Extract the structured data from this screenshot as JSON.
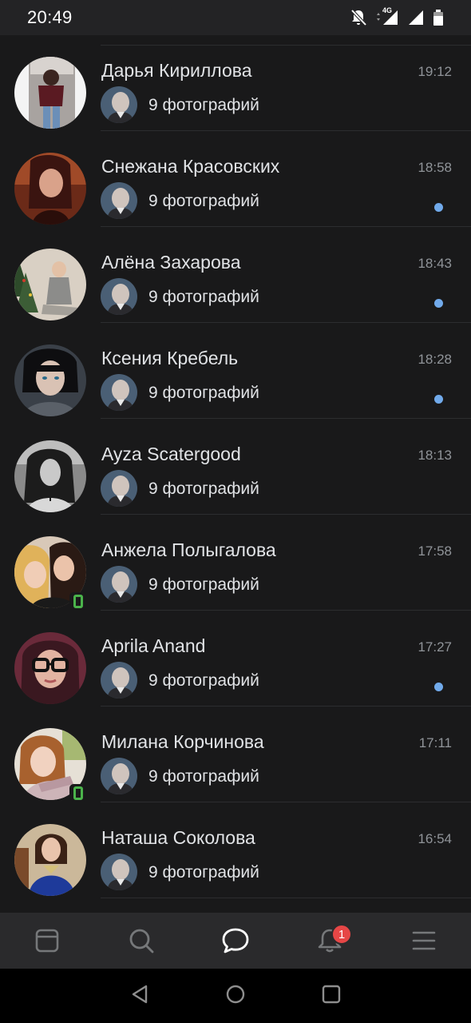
{
  "status_bar": {
    "time": "20:49",
    "network_label": "4G",
    "icons": [
      "bell-muted-icon",
      "data-arrows-icon",
      "signal-icon",
      "signal-icon",
      "battery-icon"
    ]
  },
  "colors": {
    "background": "#19191a",
    "status_bar": "#232325",
    "tab_bar": "#2a2a2c",
    "unread_dot": "#71aaeb",
    "online_badge": "#4bb34b",
    "notification_badge": "#e64646",
    "text_primary": "#e1e3e6",
    "text_secondary": "#909499"
  },
  "dialogs": [
    {
      "name": "Дарья Кириллова",
      "time": "19:12",
      "preview": "9 фотографий",
      "unread": false,
      "online_mobile": false
    },
    {
      "name": "Снежана Красовских",
      "time": "18:58",
      "preview": "9 фотографий",
      "unread": true,
      "online_mobile": false
    },
    {
      "name": "Алёна Захарова",
      "time": "18:43",
      "preview": "9 фотографий",
      "unread": true,
      "online_mobile": false
    },
    {
      "name": "Ксения Кребель",
      "time": "18:28",
      "preview": "9 фотографий",
      "unread": true,
      "online_mobile": false
    },
    {
      "name": "Ayza Scatergood",
      "time": "18:13",
      "preview": "9 фотографий",
      "unread": false,
      "online_mobile": false
    },
    {
      "name": "Анжела Полыгалова",
      "time": "17:58",
      "preview": "9 фотографий",
      "unread": false,
      "online_mobile": true
    },
    {
      "name": "Aprila Anand",
      "time": "17:27",
      "preview": "9 фотографий",
      "unread": true,
      "online_mobile": false
    },
    {
      "name": "Милана Корчинова",
      "time": "17:11",
      "preview": "9 фотографий",
      "unread": false,
      "online_mobile": true
    },
    {
      "name": "Наташа Соколова",
      "time": "16:54",
      "preview": "9 фотографий",
      "unread": false,
      "online_mobile": false
    }
  ],
  "tab_bar": {
    "tabs": [
      {
        "icon": "news-icon",
        "active": false
      },
      {
        "icon": "search-icon",
        "active": false
      },
      {
        "icon": "messages-icon",
        "active": true
      },
      {
        "icon": "bell-icon",
        "active": false,
        "badge": "1"
      },
      {
        "icon": "menu-icon",
        "active": false
      }
    ]
  },
  "nav_bar": {
    "buttons": [
      "back-icon",
      "home-icon",
      "recents-icon"
    ]
  }
}
